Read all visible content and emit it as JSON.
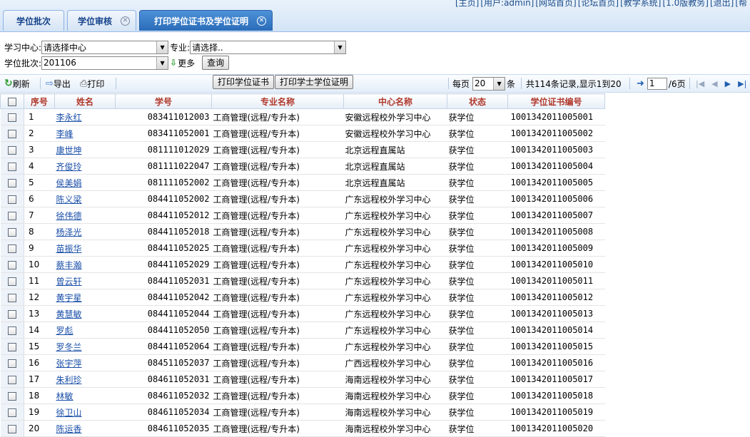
{
  "header": {
    "links": [
      "[主页]",
      "[用户:admin]",
      "[网站首页]",
      "[论坛首页]",
      "[教学系统]",
      "[1.0版教务]",
      "[退出]",
      "[帮"
    ]
  },
  "tabs": [
    {
      "label": "学位批次",
      "active": false,
      "closable": false
    },
    {
      "label": "学位审核",
      "active": false,
      "closable": true
    },
    {
      "label": "打印学位证书及学位证明",
      "active": true,
      "closable": true
    }
  ],
  "filters": {
    "center_label": "学习中心:",
    "center_value": "请选择中心",
    "major_label": "专业:",
    "major_value": "请选择..",
    "batch_label": "学位批次:",
    "batch_value": "201106",
    "more_label": "更多",
    "query_button": "查询"
  },
  "toolbar": {
    "refresh": "刷新",
    "export": "导出",
    "print": "打印",
    "print_cert_button": "打印学位证书",
    "print_proof_button": "打印学士学位证明",
    "per_page_label": "每页",
    "per_page_value": "20",
    "per_page_unit": "条",
    "record_summary": "共114条记录,显示1到20",
    "page_value": "1",
    "page_total": "/6页"
  },
  "table": {
    "columns": [
      "序号",
      "姓名",
      "学号",
      "专业名称",
      "中心名称",
      "状态",
      "学位证书编号"
    ],
    "rows": [
      {
        "no": "1",
        "name": "李永红",
        "sid": "083411012003",
        "major": "工商管理(远程/专升本)",
        "center": "安徽远程校外学习中心",
        "status": "获学位",
        "cert": "1001342011005001"
      },
      {
        "no": "2",
        "name": "李峰",
        "sid": "083411052001",
        "major": "工商管理(远程/专升本)",
        "center": "安徽远程校外学习中心",
        "status": "获学位",
        "cert": "1001342011005002"
      },
      {
        "no": "3",
        "name": "康世坤",
        "sid": "081111012029",
        "major": "工商管理(远程/专升本)",
        "center": "北京远程直属站",
        "status": "获学位",
        "cert": "1001342011005003"
      },
      {
        "no": "4",
        "name": "齐俊玲",
        "sid": "081111022047",
        "major": "工商管理(远程/专升本)",
        "center": "北京远程直属站",
        "status": "获学位",
        "cert": "1001342011005004"
      },
      {
        "no": "5",
        "name": "侯美娟",
        "sid": "081111052002",
        "major": "工商管理(远程/专升本)",
        "center": "北京远程直属站",
        "status": "获学位",
        "cert": "1001342011005005"
      },
      {
        "no": "6",
        "name": "陈义梁",
        "sid": "084411052002",
        "major": "工商管理(远程/专升本)",
        "center": "广东远程校外学习中心",
        "status": "获学位",
        "cert": "1001342011005006"
      },
      {
        "no": "7",
        "name": "徐伟德",
        "sid": "084411052012",
        "major": "工商管理(远程/专升本)",
        "center": "广东远程校外学习中心",
        "status": "获学位",
        "cert": "1001342011005007"
      },
      {
        "no": "8",
        "name": "杨泽光",
        "sid": "084411052018",
        "major": "工商管理(远程/专升本)",
        "center": "广东远程校外学习中心",
        "status": "获学位",
        "cert": "1001342011005008"
      },
      {
        "no": "9",
        "name": "苗振华",
        "sid": "084411052025",
        "major": "工商管理(远程/专升本)",
        "center": "广东远程校外学习中心",
        "status": "获学位",
        "cert": "1001342011005009"
      },
      {
        "no": "10",
        "name": "蔡丰瀚",
        "sid": "084411052029",
        "major": "工商管理(远程/专升本)",
        "center": "广东远程校外学习中心",
        "status": "获学位",
        "cert": "1001342011005010"
      },
      {
        "no": "11",
        "name": "曾云轩",
        "sid": "084411052031",
        "major": "工商管理(远程/专升本)",
        "center": "广东远程校外学习中心",
        "status": "获学位",
        "cert": "1001342011005011"
      },
      {
        "no": "12",
        "name": "黄宇星",
        "sid": "084411052042",
        "major": "工商管理(远程/专升本)",
        "center": "广东远程校外学习中心",
        "status": "获学位",
        "cert": "1001342011005012"
      },
      {
        "no": "13",
        "name": "黄慧敏",
        "sid": "084411052044",
        "major": "工商管理(远程/专升本)",
        "center": "广东远程校外学习中心",
        "status": "获学位",
        "cert": "1001342011005013"
      },
      {
        "no": "14",
        "name": "罗彪",
        "sid": "084411052050",
        "major": "工商管理(远程/专升本)",
        "center": "广东远程校外学习中心",
        "status": "获学位",
        "cert": "1001342011005014"
      },
      {
        "no": "15",
        "name": "罗冬兰",
        "sid": "084411052064",
        "major": "工商管理(远程/专升本)",
        "center": "广东远程校外学习中心",
        "status": "获学位",
        "cert": "1001342011005015"
      },
      {
        "no": "16",
        "name": "张宇萍",
        "sid": "084511052037",
        "major": "工商管理(远程/专升本)",
        "center": "广西远程校外学习中心",
        "status": "获学位",
        "cert": "1001342011005016"
      },
      {
        "no": "17",
        "name": "朱利珍",
        "sid": "084611052031",
        "major": "工商管理(远程/专升本)",
        "center": "海南远程校外学习中心",
        "status": "获学位",
        "cert": "1001342011005017"
      },
      {
        "no": "18",
        "name": "林敏",
        "sid": "084611052032",
        "major": "工商管理(远程/专升本)",
        "center": "海南远程校外学习中心",
        "status": "获学位",
        "cert": "1001342011005018"
      },
      {
        "no": "19",
        "name": "徐卫山",
        "sid": "084611052034",
        "major": "工商管理(远程/专升本)",
        "center": "海南远程校外学习中心",
        "status": "获学位",
        "cert": "1001342011005019"
      },
      {
        "no": "20",
        "name": "陈运香",
        "sid": "084611052035",
        "major": "工商管理(远程/专升本)",
        "center": "海南远程校外学习中心",
        "status": "获学位",
        "cert": "1001342011005020"
      }
    ]
  },
  "colors": {
    "accent": "#2a6cb8",
    "header_text": "#b0382a",
    "link": "#1a4fa8"
  }
}
